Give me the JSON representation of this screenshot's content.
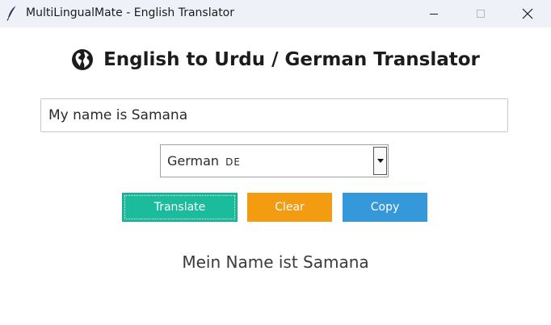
{
  "window": {
    "title": "MultiLingualMate - English Translator",
    "controls": {
      "minimize_icon": "minimize-icon",
      "maximize_icon": "maximize-icon",
      "close_icon": "close-icon"
    }
  },
  "header": {
    "icon": "globe-icon",
    "title": "English to Urdu / German Translator"
  },
  "input": {
    "value": "My name is Samana",
    "placeholder": ""
  },
  "language_select": {
    "selected": "German 🇩🇪",
    "selected_text": "German",
    "flag": "DE"
  },
  "buttons": {
    "translate": "Translate",
    "clear": "Clear",
    "copy": "Copy"
  },
  "output": {
    "text": "Mein Name ist Samana"
  },
  "colors": {
    "translate": "#1abc9c",
    "clear": "#f39c12",
    "copy": "#3498db"
  }
}
